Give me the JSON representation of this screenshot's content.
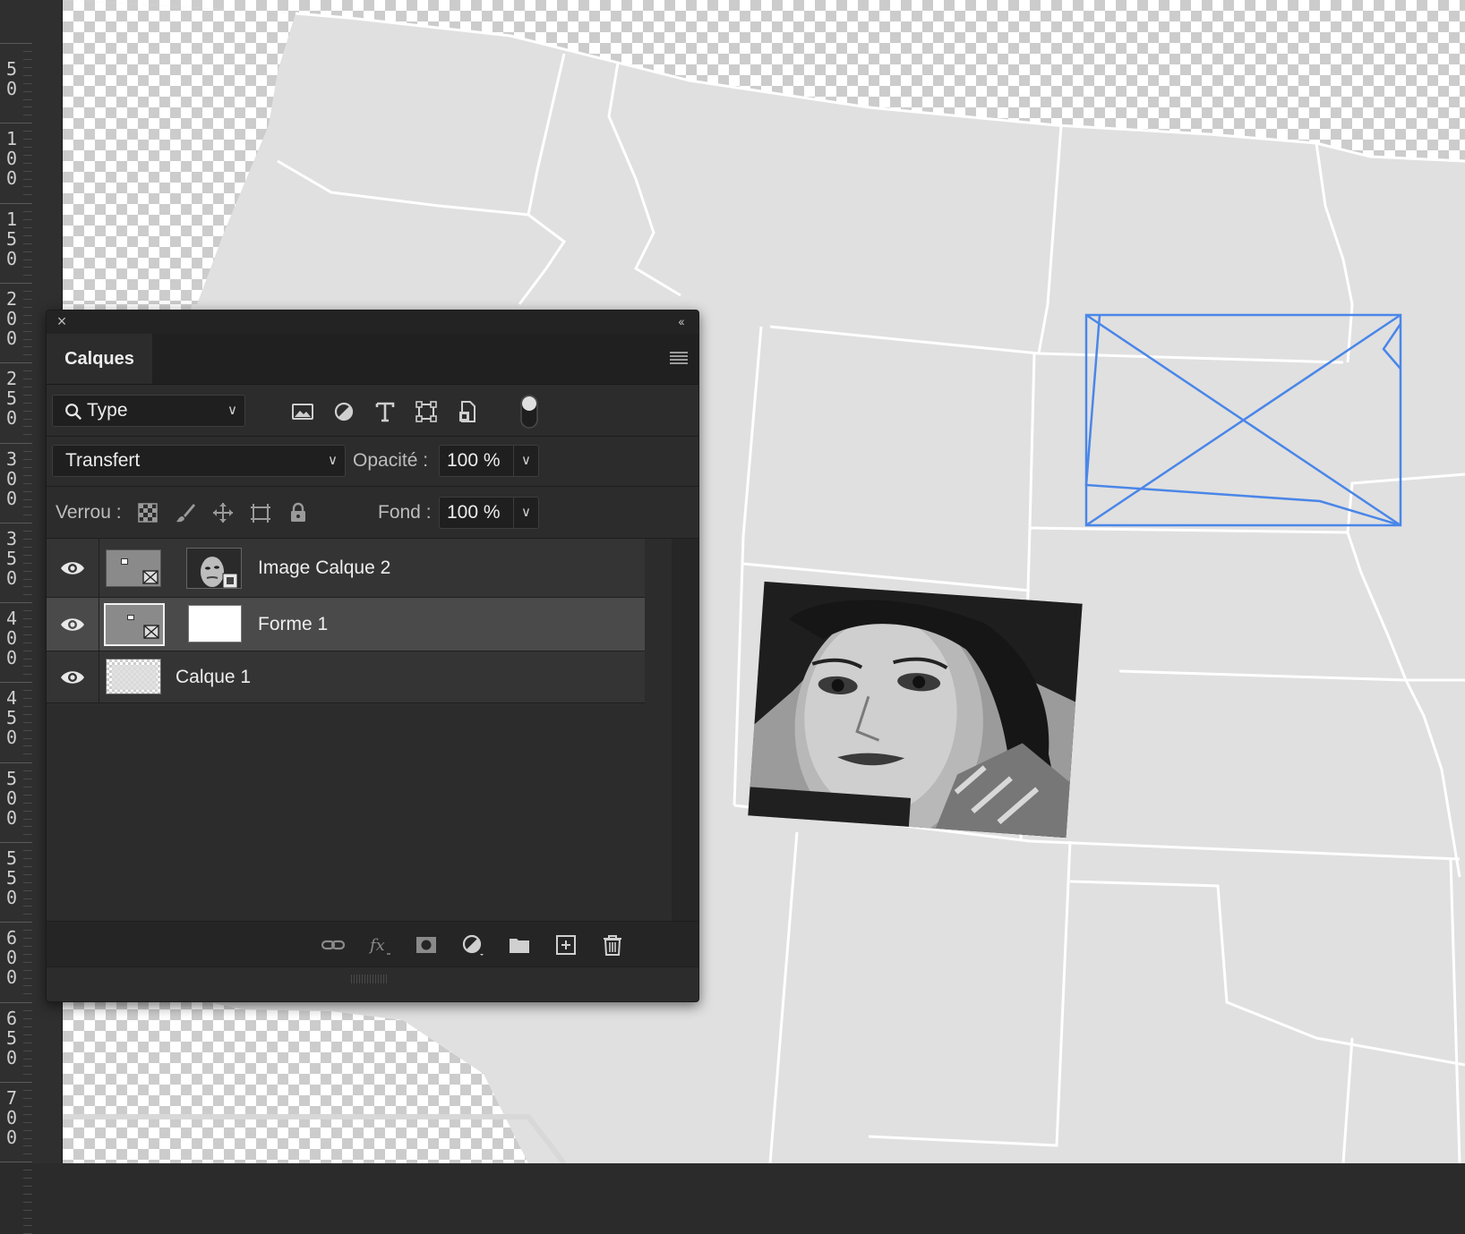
{
  "ruler": {
    "labels": [
      "50",
      "100",
      "150",
      "200",
      "250",
      "300",
      "350",
      "400",
      "450",
      "500",
      "550",
      "600",
      "650",
      "700"
    ]
  },
  "canvas": {
    "map_fill": "#e0e0e0",
    "border_color": "#ffffff",
    "selection_color": "#4a86e8"
  },
  "panel": {
    "close_icon": "×",
    "collapse_icon": "‹‹",
    "tab_label": "Calques",
    "filter": {
      "value": "Type",
      "icon": "search-icon"
    },
    "filter_icons": [
      "image-filter-icon",
      "adjustment-filter-icon",
      "type-filter-icon",
      "shape-filter-icon",
      "smart-object-filter-icon",
      "filter-toggle-icon"
    ],
    "blend_mode": "Transfert",
    "opacity_label": "Opacité :",
    "opacity_value": "100 %",
    "lock_label": "Verrou :",
    "lock_icons": [
      "lock-transparency-icon",
      "lock-pixels-icon",
      "lock-position-icon",
      "lock-artboard-icon",
      "lock-all-icon"
    ],
    "fill_label": "Fond :",
    "fill_value": "100 %",
    "layers": [
      {
        "name": "Image Calque 2",
        "visible": true,
        "selected": false
      },
      {
        "name": "Forme 1",
        "visible": true,
        "selected": true
      },
      {
        "name": "Calque 1",
        "visible": true,
        "selected": false
      }
    ],
    "bottom_icons": [
      "link-layers-icon",
      "fx-icon",
      "add-mask-icon",
      "new-adjustment-icon",
      "new-group-icon",
      "new-layer-icon",
      "delete-layer-icon"
    ],
    "colors": {
      "panel_bg": "#2c2c2c",
      "selected_row": "#4a4a4a",
      "row_bg": "#333333"
    }
  }
}
